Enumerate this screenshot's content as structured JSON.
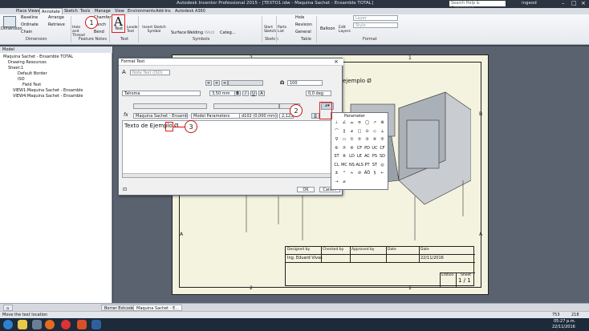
{
  "titlebar": {
    "title": "Autodesk Inventor Professional 2015 - [TEXTO1.idw - Maquina Sachet - Ensamble TOTAL]",
    "search_placeholder": "Search Help & Commands...",
    "user": "ingeod"
  },
  "ribbon_tabs": [
    "Place Views",
    "Annotate",
    "Sketch",
    "Tools",
    "Manage",
    "View",
    "Environments",
    "Add-Ins",
    "Autodesk A360"
  ],
  "ribbon": {
    "dimension": {
      "big": "Dimension",
      "items": [
        "Baseline",
        "Ordinate",
        "Chain",
        "Arrange",
        "Retrieve"
      ],
      "group": "Dimension"
    },
    "feature_notes": {
      "items": [
        "Hole and Thread",
        "Chamfer",
        "Punch",
        "Bend"
      ],
      "group": "Feature Notes"
    },
    "text": {
      "items": [
        "Text",
        "Leader Text"
      ],
      "group": "Text"
    },
    "symbols": {
      "items": [
        "Insert Sketch Symbol",
        "Surface",
        "Welding",
        "Weld",
        "Categ..."
      ],
      "group": "Symbols"
    },
    "sketch": {
      "items": [
        "Start Sketch"
      ],
      "group": "Sketch"
    },
    "table": {
      "items": [
        "Parts List",
        "Hole",
        "Revision",
        "General"
      ],
      "group": "Table"
    },
    "balloon": {
      "label": "Balloon",
      "group": ""
    },
    "layers": {
      "label": "Edit Layers"
    },
    "format": {
      "layer": "Layer",
      "style": "Style",
      "group": "Format"
    }
  },
  "browser": {
    "header": "Model",
    "items": [
      "Maquina Sachet - Ensamble TOTAL",
      "Drawing Resources",
      "Sheet:1",
      "Default Border",
      "ISO",
      "Field Text",
      "VIEW1:Maquina Sachet - Ensamble",
      "VIEW4:Maquina Sachet - Ensamble"
    ]
  },
  "dialog": {
    "title": "Format Text",
    "style": "Note Text (ISO)",
    "scale": "100",
    "font": "Tahoma",
    "size": "3,50 mm",
    "rotation": "0,0 deg",
    "component": "Maquina Sachet - Ensamble TOTA",
    "source": "Model Parameters",
    "parameter": "d102 (0,000 mm)",
    "precision": "2,123",
    "edit_text": "Texto de Ejemplo Ø",
    "ok": "OK",
    "cancel": "Canc..."
  },
  "palette": {
    "header": "Parameter",
    "symbols": [
      "⊥",
      "∠",
      "⌓",
      "≡",
      "◯",
      "↗",
      "⊕",
      "⌒",
      "∥",
      "⌀",
      "□",
      "⊙",
      "◇",
      "⟂",
      "∇",
      "▭",
      "①",
      "②",
      "③",
      "④",
      "⑤",
      "⑥",
      "⑦",
      "⑧",
      "CF",
      "PD",
      "UC",
      "CF",
      "ST",
      "⑧",
      "LD",
      "LE",
      "AC",
      "PS",
      "SD",
      "CL",
      "MC",
      "NS",
      "ALS",
      "PT",
      "ST",
      "◎",
      "±",
      "°",
      "≈",
      "⊘",
      "ÄÖ",
      "§",
      "←",
      "→",
      "⌀"
    ]
  },
  "callouts": [
    "1",
    "2",
    "3"
  ],
  "drawing": {
    "zones_top": [
      "2",
      "1"
    ],
    "zones_side": [
      "B",
      "A"
    ],
    "zones_bottom": [
      "2",
      "1"
    ],
    "title_block": {
      "designed_by": "Designed by",
      "checked_by": "Checked by",
      "approved_by": "Approved by",
      "date": "Date",
      "date2": "Date",
      "designer": "Ing. Eduard Vivas",
      "date_value": "22/11/2016",
      "edition": "Edition",
      "sheet": "Sheet",
      "sheet_value": "1 / 1"
    },
    "preview_text": "ejemplo Ø"
  },
  "doc_tabs": [
    "Borrar Estcode",
    "Maquina Sachet - E..."
  ],
  "status": {
    "message": "Move the text location",
    "count1": "753",
    "count2": "218"
  },
  "taskbar": {
    "time": "05:27 p.m.",
    "date": "22/11/2016"
  }
}
